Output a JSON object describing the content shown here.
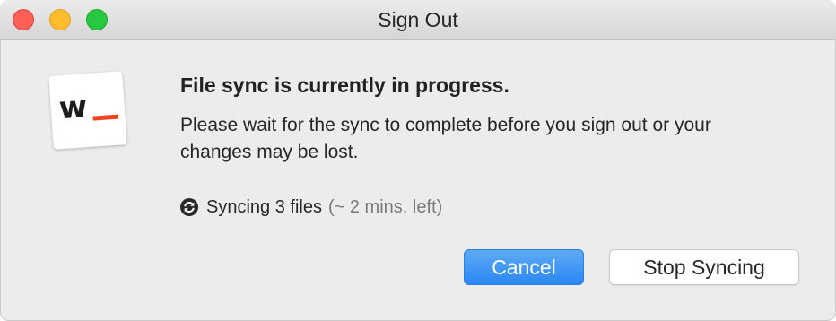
{
  "window": {
    "title": "Sign Out"
  },
  "dialog": {
    "heading": "File sync is currently in progress.",
    "message": "Please wait for the sync to complete before you sign out or your changes may be lost.",
    "status": {
      "text": "Syncing 3 files",
      "eta": "(~ 2 mins. left)",
      "icon": "sync-icon"
    },
    "app_icon": "wunderlist-w-icon"
  },
  "buttons": {
    "cancel": "Cancel",
    "stop_syncing": "Stop Syncing"
  },
  "colors": {
    "close": "#fe5f57",
    "minimize": "#febc2e",
    "zoom": "#28c840",
    "accent": "#2b87f3",
    "brand": "#f0441f"
  }
}
